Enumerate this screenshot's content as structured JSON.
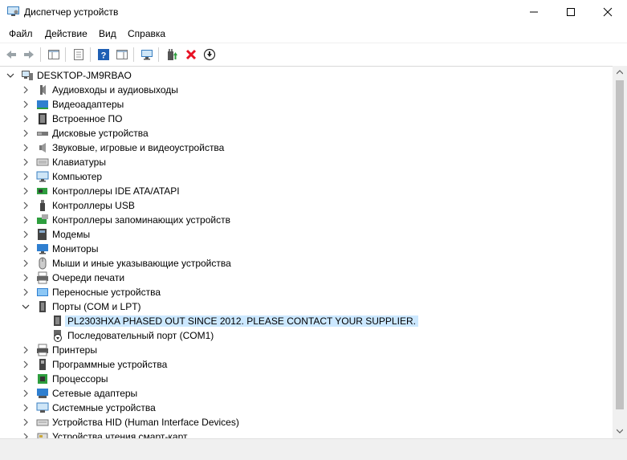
{
  "window": {
    "title": "Диспетчер устройств"
  },
  "menu": [
    {
      "label": "Файл"
    },
    {
      "label": "Действие"
    },
    {
      "label": "Вид"
    },
    {
      "label": "Справка"
    }
  ],
  "tree": {
    "root": "DESKTOP-JM9RBAO",
    "items": [
      {
        "label": "Аудиовходы и аудиовыходы",
        "icon": "audio-icon"
      },
      {
        "label": "Видеоадаптеры",
        "icon": "display-adapter-icon"
      },
      {
        "label": "Встроенное ПО",
        "icon": "firmware-icon"
      },
      {
        "label": "Дисковые устройства",
        "icon": "disk-drive-icon"
      },
      {
        "label": "Звуковые, игровые и видеоустройства",
        "icon": "speaker-icon"
      },
      {
        "label": "Клавиатуры",
        "icon": "keyboard-icon"
      },
      {
        "label": "Компьютер",
        "icon": "computer-icon"
      },
      {
        "label": "Контроллеры IDE ATA/ATAPI",
        "icon": "ide-controller-icon"
      },
      {
        "label": "Контроллеры USB",
        "icon": "usb-icon"
      },
      {
        "label": "Контроллеры запоминающих устройств",
        "icon": "storage-controller-icon"
      },
      {
        "label": "Модемы",
        "icon": "modem-icon"
      },
      {
        "label": "Мониторы",
        "icon": "monitor-icon"
      },
      {
        "label": "Мыши и иные указывающие устройства",
        "icon": "mouse-icon"
      },
      {
        "label": "Очереди печати",
        "icon": "print-queue-icon"
      },
      {
        "label": "Переносные устройства",
        "icon": "portable-device-icon"
      },
      {
        "label": "Порты (COM и LPT)",
        "icon": "port-icon",
        "expanded": true
      },
      {
        "label": "PL2303HXA PHASED OUT SINCE 2012. PLEASE CONTACT YOUR SUPPLIER.",
        "icon": "port-warning-icon",
        "child": true,
        "selected": true
      },
      {
        "label": "Последовательный порт (COM1)",
        "icon": "serial-port-icon",
        "child": true
      },
      {
        "label": "Принтеры",
        "icon": "printer-icon"
      },
      {
        "label": "Программные устройства",
        "icon": "software-device-icon"
      },
      {
        "label": "Процессоры",
        "icon": "processor-icon"
      },
      {
        "label": "Сетевые адаптеры",
        "icon": "network-adapter-icon"
      },
      {
        "label": "Системные устройства",
        "icon": "system-device-icon"
      },
      {
        "label": "Устройства HID (Human Interface Devices)",
        "icon": "hid-icon"
      },
      {
        "label": "Устройства чтения смарт-карт",
        "icon": "smart-card-reader-icon"
      }
    ]
  },
  "colors": {
    "selection": "#cce8ff",
    "accent_blue": "#1e90d6",
    "delete_red": "#e81123",
    "enable_green": "#2e9e3e"
  }
}
